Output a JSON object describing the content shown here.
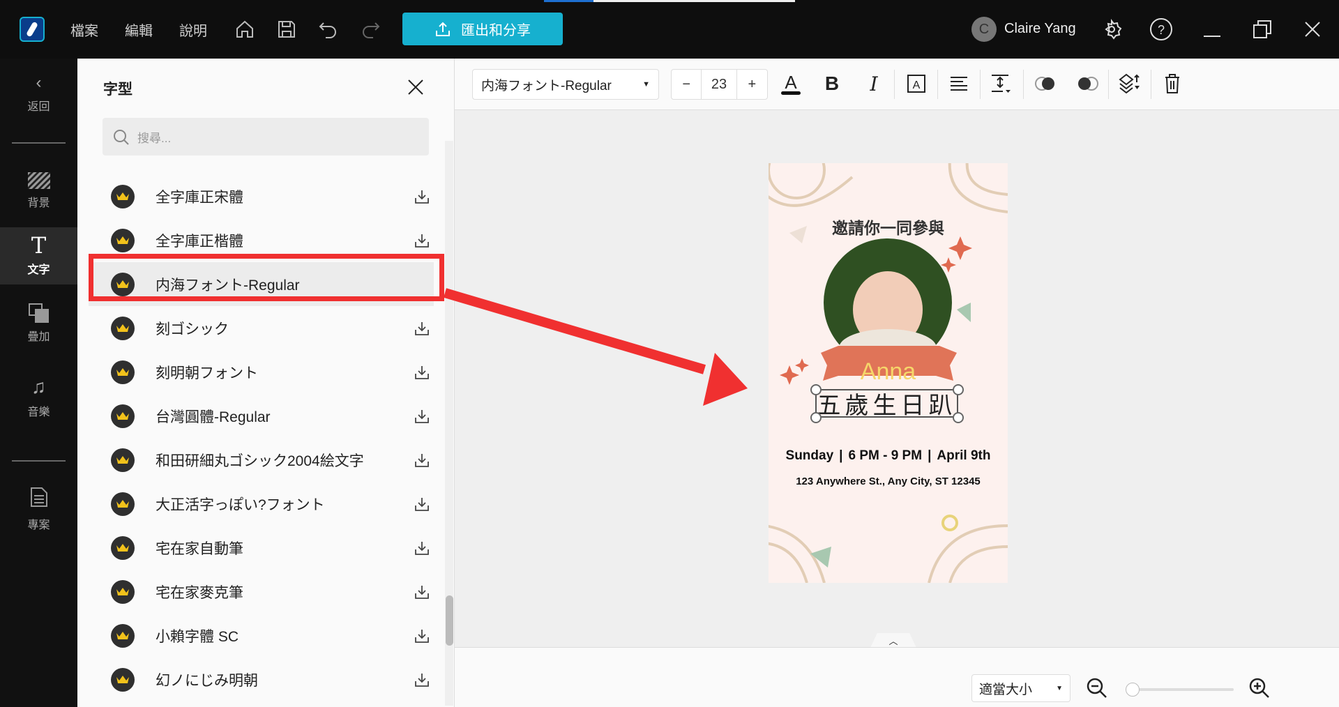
{
  "app": {
    "menu": [
      "檔案",
      "編輯",
      "說明"
    ],
    "export_label": "匯出和分享",
    "user_initial": "C",
    "user_name": "Claire Yang",
    "accent": "#16b0cf"
  },
  "sidebar": {
    "items": [
      {
        "label": "返回",
        "icon": "chevron-left-icon"
      },
      {
        "label": "背景",
        "icon": "hatch-icon"
      },
      {
        "label": "文字",
        "icon": "text-icon"
      },
      {
        "label": "疊加",
        "icon": "overlay-icon"
      },
      {
        "label": "音樂",
        "icon": "music-icon"
      },
      {
        "label": "專案",
        "icon": "document-icon"
      }
    ],
    "active": "文字"
  },
  "panel": {
    "title": "字型",
    "search_placeholder": "搜尋...",
    "fonts": [
      "全字庫正宋體",
      "全字庫正楷體",
      "内海フォント-Regular",
      "刻ゴシック",
      "刻明朝フォント",
      "台灣圓體-Regular",
      "和田研細丸ゴシック2004絵文字",
      "大正活字っぽい?フォント",
      "宅在家自動筆",
      "宅在家麥克筆",
      "小賴字體 SC",
      "幻ノにじみ明朝"
    ],
    "selected_index": 2,
    "highlight_color": "#f03030"
  },
  "toolbar": {
    "font": "内海フォント-Regular",
    "size": "23",
    "size_minus": "−",
    "size_plus": "+"
  },
  "card": {
    "invite": "邀請你一同參與",
    "name": "Anna",
    "title": "五歲生日趴",
    "day": "Sunday",
    "time": "6 PM - 9 PM",
    "date": "April 9th",
    "address": "123 Anywhere St., Any City, ST 12345"
  },
  "bottom": {
    "fit": "適當大小",
    "zoom_fraction": 0
  }
}
